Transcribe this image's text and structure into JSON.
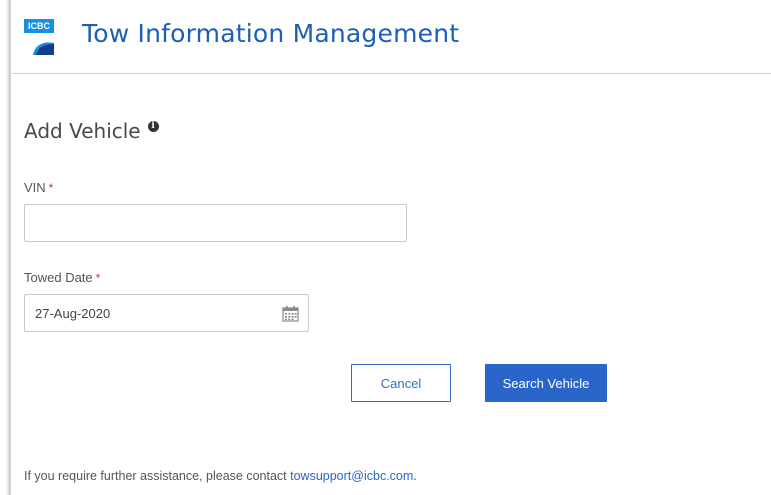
{
  "header": {
    "logo_text": "ICBC",
    "title": "Tow Information Management"
  },
  "form": {
    "heading": "Add Vehicle",
    "info_icon_glyph": "i",
    "vin": {
      "label": "VIN",
      "required_mark": "*",
      "value": "",
      "placeholder": ""
    },
    "towed_date": {
      "label": "Towed Date",
      "required_mark": "*",
      "value": "27-Aug-2020",
      "icon": "calendar-icon"
    },
    "cancel_label": "Cancel",
    "search_label": "Search Vehicle"
  },
  "footer": {
    "text": "If you require further assistance, please contact",
    "email": "towsupport@icbc.com",
    "suffix": "."
  },
  "colors": {
    "brand_blue": "#1e5fb6",
    "primary_button": "#2a66c9",
    "required": "#d0312d"
  }
}
